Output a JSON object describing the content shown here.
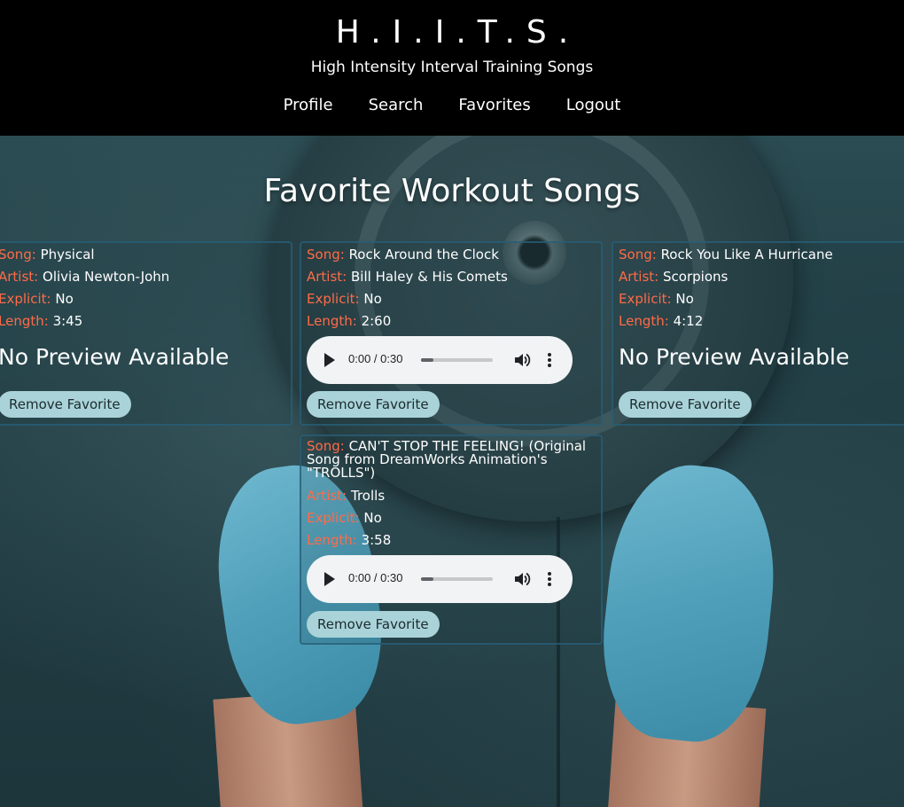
{
  "header": {
    "brand": "H.I.I.T.S.",
    "tagline": "High Intensity Interval Training Songs",
    "nav": [
      "Profile",
      "Search",
      "Favorites",
      "Logout"
    ]
  },
  "main": {
    "title": "Favorite Workout Songs"
  },
  "labels": {
    "song": "Song:",
    "artist": "Artist:",
    "explicit": "Explicit:",
    "length": "Length:",
    "no_preview": "No Preview Available",
    "remove": "Remove Favorite"
  },
  "songs": [
    {
      "song": "Physical",
      "artist": "Olivia Newton-John",
      "explicit": "No",
      "length": "3:45",
      "preview": false
    },
    {
      "song": "Rock Around the Clock",
      "artist": "Bill Haley & His Comets",
      "explicit": "No",
      "length": "2:60",
      "preview": true,
      "player_time": "0:00 / 0:30"
    },
    {
      "song": "Rock You Like A Hurricane",
      "artist": "Scorpions",
      "explicit": "No",
      "length": "4:12",
      "preview": false
    },
    {
      "song": "CAN'T STOP THE FEELING! (Original Song from DreamWorks Animation's \"TROLLS\")",
      "artist": "Trolls",
      "explicit": "No",
      "length": "3:58",
      "preview": true,
      "player_time": "0:00 / 0:30"
    }
  ],
  "colors": {
    "accent": "#ff6b47",
    "button": "#a9d3d9",
    "header_bg": "#000000",
    "card_border": "#285f78"
  },
  "icons": [
    "play-icon",
    "volume-icon",
    "more-options-icon"
  ]
}
